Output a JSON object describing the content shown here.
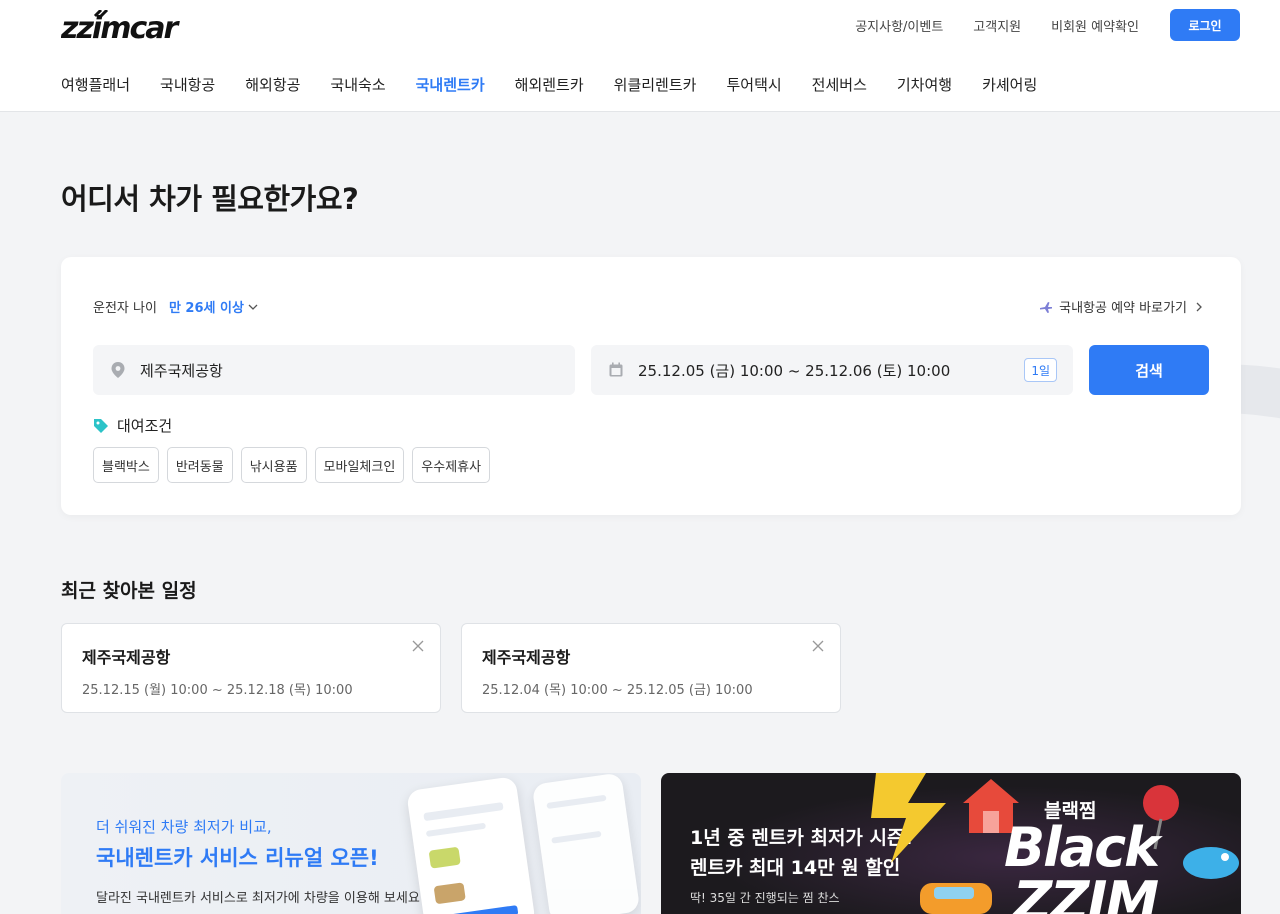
{
  "header": {
    "logo_text": "zzimcar",
    "util_links": [
      "공지사항/이벤트",
      "고객지원",
      "비회원 예약확인"
    ],
    "login_label": "로그인",
    "nav": [
      "여행플래너",
      "국내항공",
      "해외항공",
      "국내숙소",
      "국내렌트카",
      "해외렌트카",
      "위클리렌트카",
      "투어택시",
      "전세버스",
      "기차여행",
      "카셰어링"
    ],
    "active_nav": "국내렌트카"
  },
  "hero": {
    "title": "어디서 차가 필요한가요?"
  },
  "search": {
    "age_label": "운전자 나이",
    "age_value": "만 26세 이상",
    "flight_link": "국내항공 예약 바로가기",
    "location": "제주국제공항",
    "dates": "25.12.05 (금) 10:00 ~ 25.12.06 (토) 10:00",
    "days_badge": "1일",
    "search_button": "검색",
    "conditions_title": "대여조건",
    "conditions": [
      "블랙박스",
      "반려동물",
      "낚시용품",
      "모바일체크인",
      "우수제휴사"
    ]
  },
  "recent": {
    "title": "최근 찾아본 일정",
    "items": [
      {
        "place": "제주국제공항",
        "dates": "25.12.15 (월) 10:00 ~ 25.12.18 (목) 10:00"
      },
      {
        "place": "제주국제공항",
        "dates": "25.12.04 (목) 10:00 ~ 25.12.05 (금) 10:00"
      }
    ]
  },
  "banners": {
    "left": {
      "line1": "더 쉬워진 차량 최저가 비교,",
      "line2": "국내렌트카 서비스 리뉴얼 오픈!",
      "line3": "달라진 국내렌트카 서비스로 최저가에 차량을 이용해 보세요"
    },
    "right": {
      "line1": "1년 중 렌트카 최저가 시즌!",
      "line2": "렌트카 최대 14만 원 할인",
      "line3": "딱! 35일 간 진행되는 찜 찬스",
      "brand_small": "블랙찜",
      "brand_big1": "Black",
      "brand_big2": "ZZIM"
    }
  },
  "colors": {
    "accent": "#2f7bf5"
  }
}
